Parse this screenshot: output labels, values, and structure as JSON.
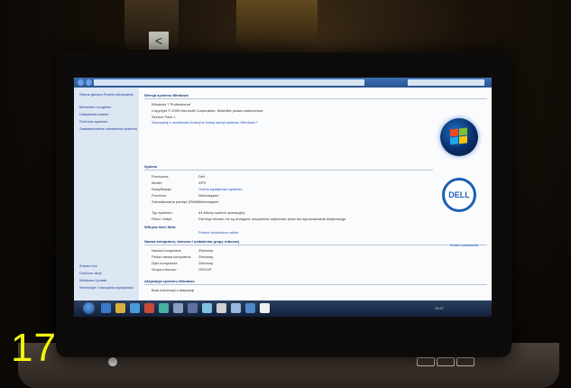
{
  "badge": {
    "number": "17"
  },
  "logo": {
    "brand": "DELL"
  },
  "explorer": {
    "sidebar": [
      "Strona główna Panelu sterowania",
      "Menedżer urządzeń",
      "Ustawienia zdalne",
      "Ochrona systemu",
      "Zaawansowane ustawienia systemu"
    ],
    "sections": {
      "edition_heading": "Wersja systemu Windows",
      "edition_name": "Windows 7 Professional",
      "copyright": "Copyright © 2009 Microsoft Corporation. Wszelkie prawa zastrzeżone.",
      "service_pack": "Service Pack 1",
      "upgrade_link": "Skorzystaj z możliwości funkcji w nowej wersji systemu Windows 7",
      "system_heading": "System",
      "computer_heading": "Nazwa komputera, domena i ustawienia grupy roboczej",
      "activation_heading": "Aktywacja systemu Windows"
    },
    "system_rows": [
      {
        "label": "Producent:",
        "value": "Dell"
      },
      {
        "label": "Model:",
        "value": "XPS"
      },
      {
        "label": "Klasyfikacja:",
        "value": "Ocena wydajności systemu"
      },
      {
        "label": "Procesor:",
        "value": "Niedostępne"
      },
      {
        "label": "Zainstalowana pamięć (RAM):",
        "value": "Niedostępne"
      },
      {
        "label": "Typ systemu:",
        "value": "64-bitowy system operacyjny"
      },
      {
        "label": "Pióro i dotyk:",
        "value": "Dla tego ekranu nie są dostępne urządzenia wejściowe pióra ani wprowadzania dotykowego"
      }
    ],
    "support": {
      "label": "Witryna sieci Web:",
      "value": "Pomoc techniczna online"
    },
    "computer_rows": [
      {
        "label": "Nazwa komputera:",
        "value": "Zbiorowy"
      },
      {
        "label": "Pełna nazwa komputera:",
        "value": "Zbiorowy"
      },
      {
        "label": "Opis komputera:",
        "value": "Zbiorowy"
      },
      {
        "label": "Grupa robocza:",
        "value": "GROUP"
      }
    ],
    "change_settings": "Zmień ustawienia",
    "activation_status": "Brak informacji o aktywacji",
    "see_also_heading": "Zobacz też",
    "see_also": [
      "Centrum akcji",
      "Windows Update",
      "Informacje i narzędzia wydajności"
    ],
    "tray_clock": "10:27"
  }
}
